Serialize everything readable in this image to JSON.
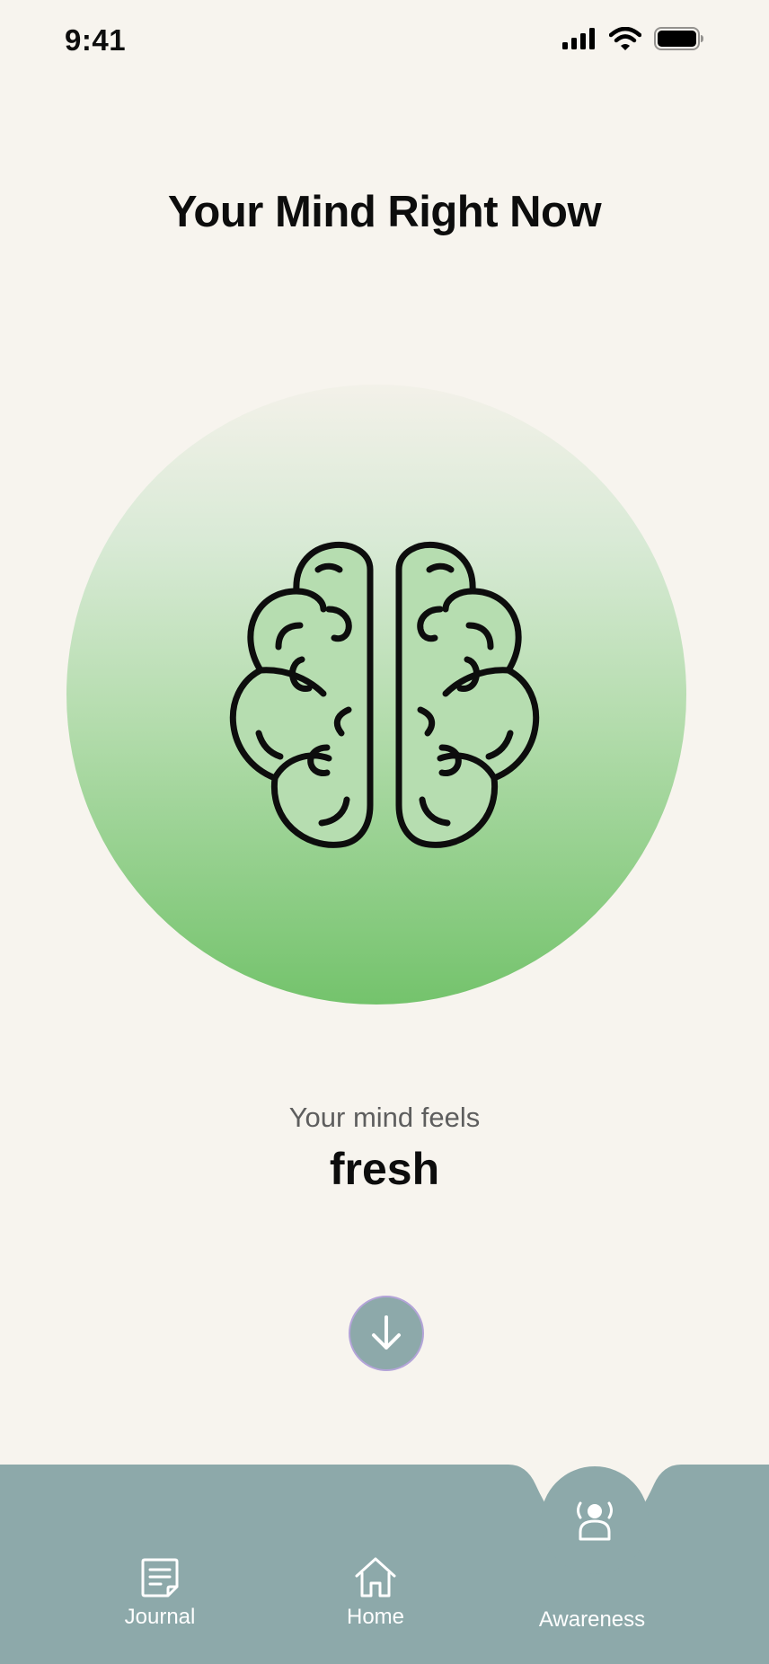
{
  "status_bar": {
    "time": "9:41"
  },
  "page": {
    "title": "Your Mind Right Now",
    "feels_label": "Your mind feels",
    "feels_value": "fresh"
  },
  "icons": {
    "brain": "brain-icon",
    "scroll_down": "arrow-down-icon",
    "journal": "journal-icon",
    "home": "home-icon",
    "awareness": "awareness-icon"
  },
  "tab_bar": {
    "tabs": [
      {
        "label": "Journal"
      },
      {
        "label": "Home"
      },
      {
        "label": "Awareness"
      }
    ]
  },
  "colors": {
    "background": "#f7f4ee",
    "tab_bar": "#8da9aa",
    "circle_top": "#f3f1e9",
    "circle_bottom": "#74c36c",
    "brain_fill": "#b6ddb0"
  }
}
